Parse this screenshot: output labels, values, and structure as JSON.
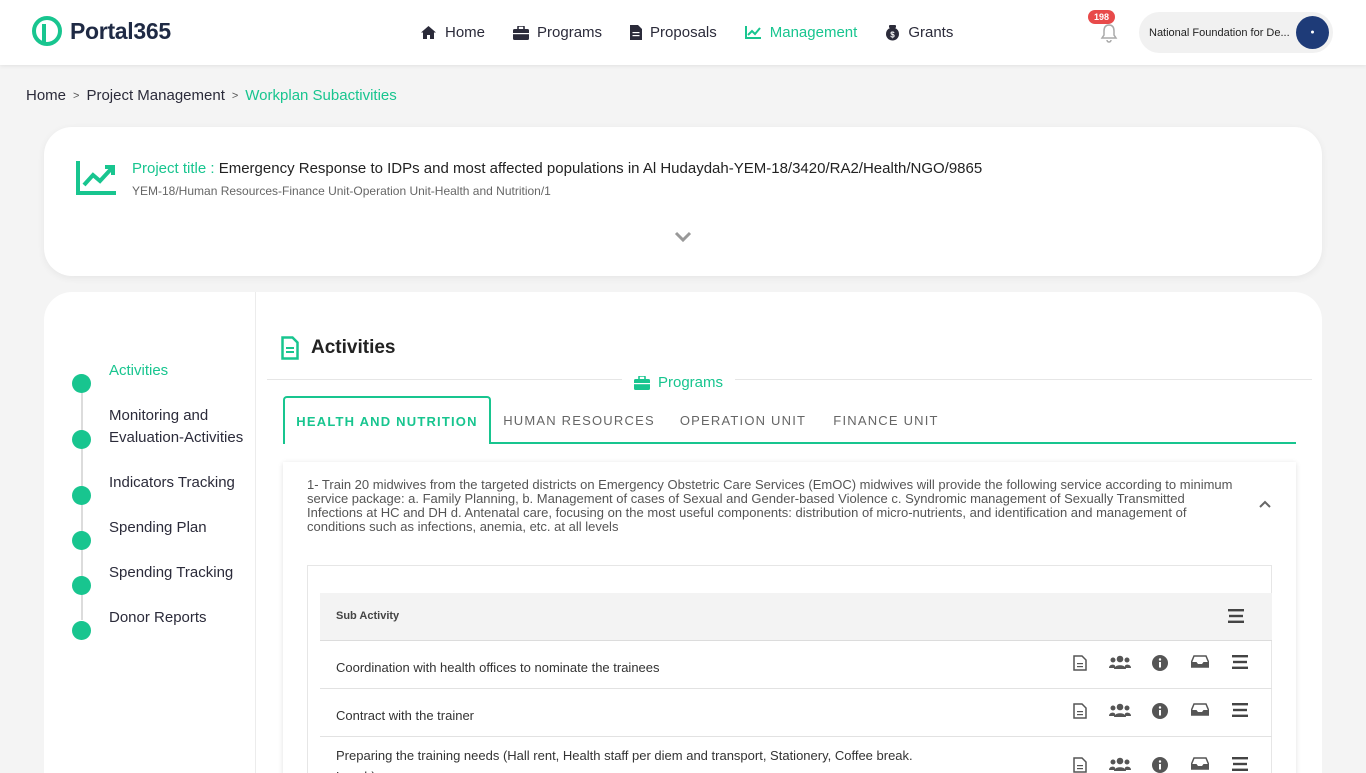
{
  "brand": {
    "name": "Portal365",
    "accent": "#18c58f"
  },
  "nav": [
    {
      "label": "Home",
      "icon": "home-icon"
    },
    {
      "label": "Programs",
      "icon": "briefcase-icon"
    },
    {
      "label": "Proposals",
      "icon": "document-icon"
    },
    {
      "label": "Management",
      "icon": "chart-line-icon",
      "active": true
    },
    {
      "label": "Grants",
      "icon": "money-bag-icon"
    }
  ],
  "notifications": {
    "count": "198"
  },
  "org": {
    "name": "National Foundation for De..."
  },
  "breadcrumb": {
    "home": "Home",
    "parent": "Project Management",
    "current": "Workplan Subactivities"
  },
  "project": {
    "label": "Project title :",
    "title": "Emergency Response to IDPs and most affected populations in Al Hudaydah-YEM-18/3420/RA2/Health/NGO/9865",
    "subtitle": "YEM-18/Human Resources-Finance Unit-Operation Unit-Health and Nutrition/1"
  },
  "sidebar": {
    "steps": [
      {
        "label": "Activities",
        "active": true
      },
      {
        "label": "Monitoring and Evaluation-Activities"
      },
      {
        "label": "Indicators Tracking"
      },
      {
        "label": "Spending Plan"
      },
      {
        "label": "Spending Tracking"
      },
      {
        "label": "Donor Reports"
      }
    ]
  },
  "activities": {
    "heading": "Activities",
    "programs_label": "Programs",
    "tabs": [
      {
        "label": "HEALTH AND NUTRITION",
        "active": true
      },
      {
        "label": "HUMAN RESOURCES"
      },
      {
        "label": "OPERATION UNIT"
      },
      {
        "label": "FINANCE UNIT"
      }
    ],
    "description": "1- Train 20 midwives from the targeted districts on Emergency Obstetric Care Services (EmOC) midwives will provide the following service according to minimum service package: a. Family Planning, b. Management of cases of Sexual and Gender-based Violence c. Syndromic management of Sexually Transmitted Infections at HC and DH d. Antenatal care, focusing on the most useful components: distribution of micro-nutrients, and identification and management of conditions such as infections, anemia, etc. at all levels",
    "table": {
      "header": "Sub Activity",
      "rows": [
        {
          "name": "Coordination with health offices to nominate the trainees"
        },
        {
          "name": "Contract with the trainer"
        },
        {
          "name": "Preparing the training needs (Hall rent, Health staff per diem and transport, Stationery, Coffee break. Lunch)"
        }
      ]
    }
  }
}
